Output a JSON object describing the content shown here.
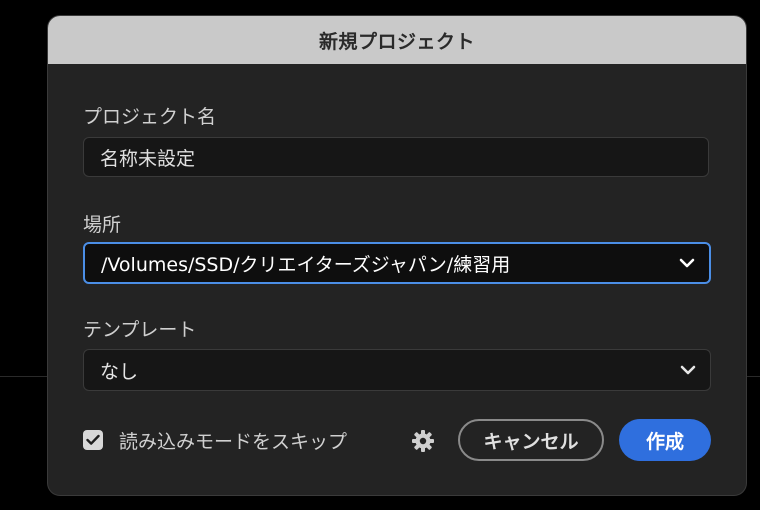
{
  "dialog": {
    "title": "新規プロジェクト"
  },
  "project_name": {
    "label": "プロジェクト名",
    "value": "名称未設定"
  },
  "location": {
    "label": "場所",
    "value": "/Volumes/SSD/クリエイターズジャパン/練習用"
  },
  "template": {
    "label": "テンプレート",
    "value": "なし"
  },
  "footer": {
    "skip_import_label": "読み込みモードをスキップ",
    "skip_import_checked": true,
    "cancel_label": "キャンセル",
    "create_label": "作成"
  },
  "colors": {
    "accent": "#2f6fde",
    "focus_ring": "#4b8ee6",
    "dialog_bg": "#232323",
    "titlebar_bg": "#c9c9c9"
  },
  "icons": {
    "chevron": "chevron-down-icon",
    "checkmark": "checkmark-icon",
    "gear": "gear-icon"
  }
}
